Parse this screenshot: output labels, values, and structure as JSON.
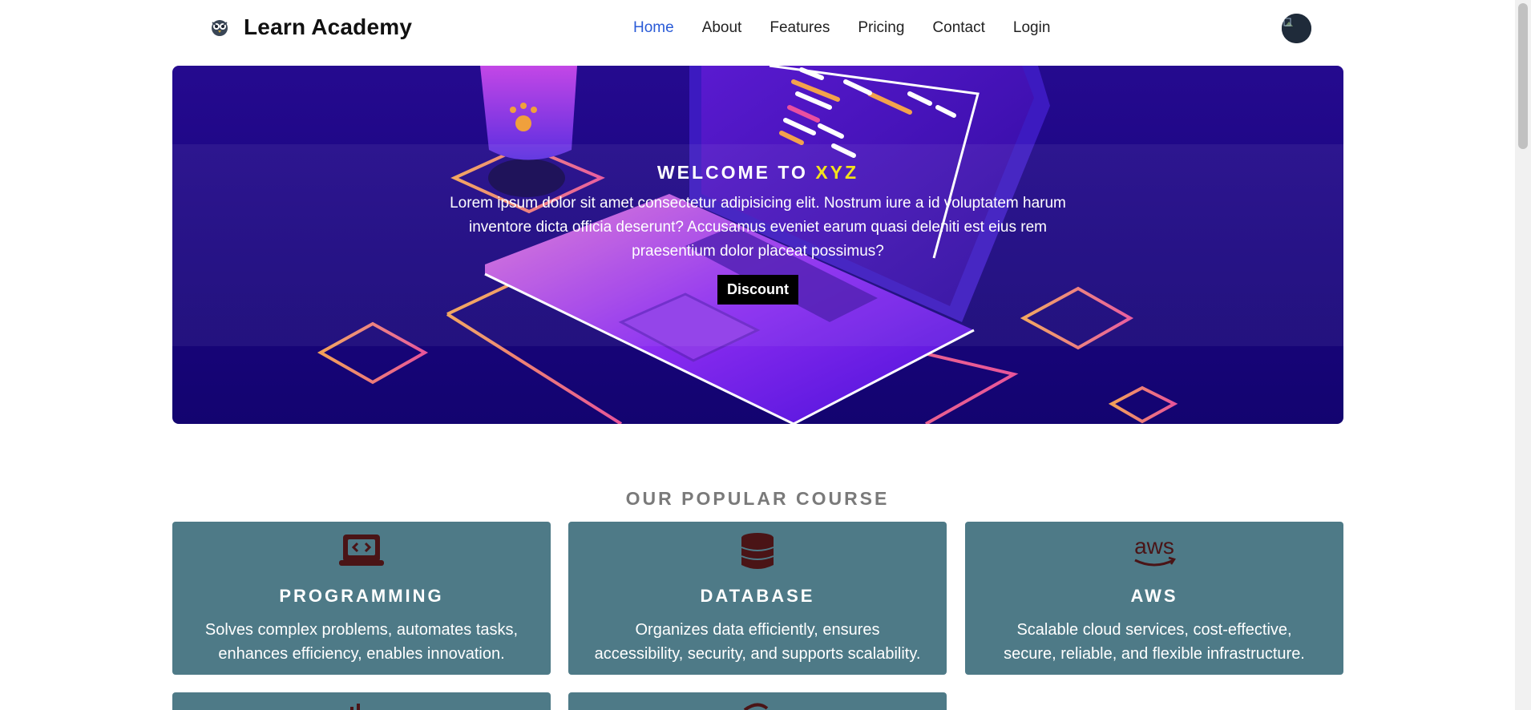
{
  "navbar": {
    "brand_name": "Learn Academy",
    "links": [
      "Home",
      "About",
      "Features",
      "Pricing",
      "Contact",
      "Login"
    ],
    "active_link": "Home"
  },
  "hero": {
    "title_prefix": "WELCOME TO",
    "title_highlight": "XYZ",
    "text": "Lorem ipsum dolor sit amet consectetur adipisicing elit. Nostrum iure a id voluptatem harum inventore dicta officia deserunt? Accusamus eveniet earum quasi deleniti est eius rem praesentium dolor placeat possimus?",
    "button_label": "Discount"
  },
  "courses": {
    "section_title": "OUR POPULAR COURSE",
    "cards": [
      {
        "title": "PROGRAMMING",
        "description": "Solves complex problems, automates tasks, enhances efficiency, enables innovation.",
        "icon": "laptop-code-icon"
      },
      {
        "title": "DATABASE",
        "description": "Organizes data efficiently, ensures accessibility, security, and supports scalability.",
        "icon": "database-icon"
      },
      {
        "title": "AWS",
        "description": "Scalable cloud services, cost-effective, secure, reliable, and flexible infrastructure.",
        "icon": "aws-icon"
      }
    ]
  },
  "colors": {
    "card_bg": "#4e7a87",
    "icon_color": "#4a1416",
    "accent": "#2a5bd7",
    "hero_highlight": "#f3e21b"
  }
}
